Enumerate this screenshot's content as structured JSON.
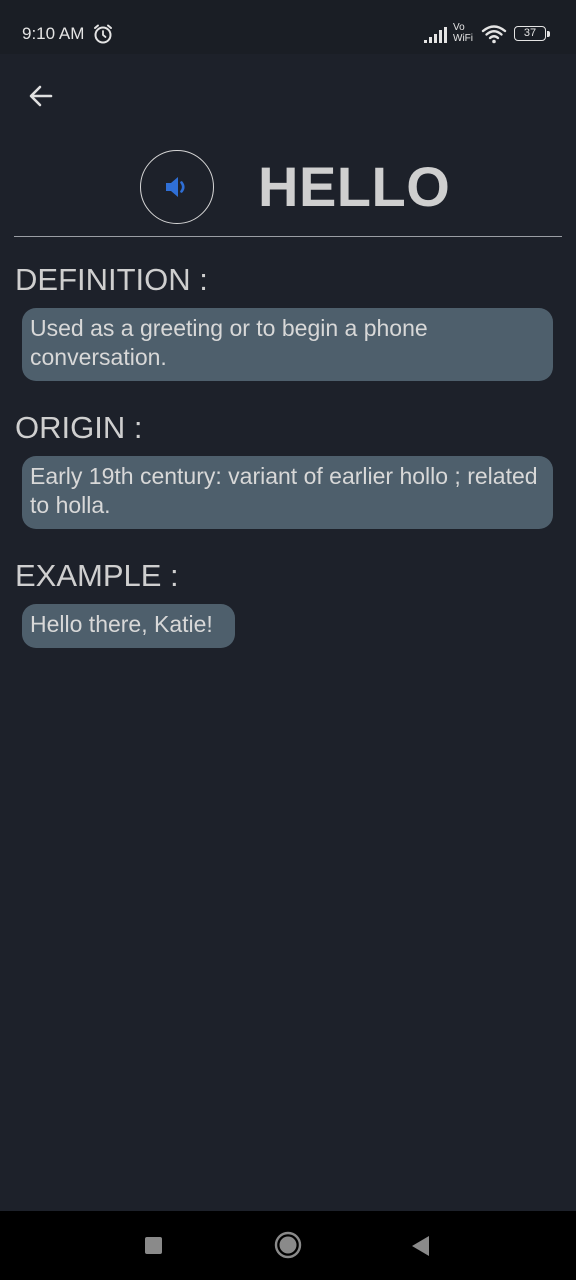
{
  "status_bar": {
    "time": "9:10 AM",
    "vowifi_top": "Vo",
    "vowifi_bottom": "WiFi",
    "battery": "37"
  },
  "header": {
    "word": "HELLO"
  },
  "sections": {
    "definition": {
      "heading": "DEFINITION :",
      "text": "Used as a greeting or to begin a phone conversation."
    },
    "origin": {
      "heading": "ORIGIN :",
      "text": "Early 19th century: variant of earlier hollo ; related to holla."
    },
    "example": {
      "heading": "EXAMPLE :",
      "text": "Hello there, Katie!"
    }
  },
  "icons": {
    "back": "arrow-left-icon",
    "speaker": "volume-icon",
    "alarm": "alarm-clock-icon",
    "signal": "signal-icon",
    "wifi": "wifi-icon",
    "battery": "battery-icon",
    "nav_recent": "square-icon",
    "nav_home": "circle-icon",
    "nav_back": "triangle-icon"
  },
  "colors": {
    "background": "#1d212a",
    "bubble": "#4e5f6c",
    "speaker_accent": "#2f6fd6",
    "text": "#cfcfcf"
  }
}
